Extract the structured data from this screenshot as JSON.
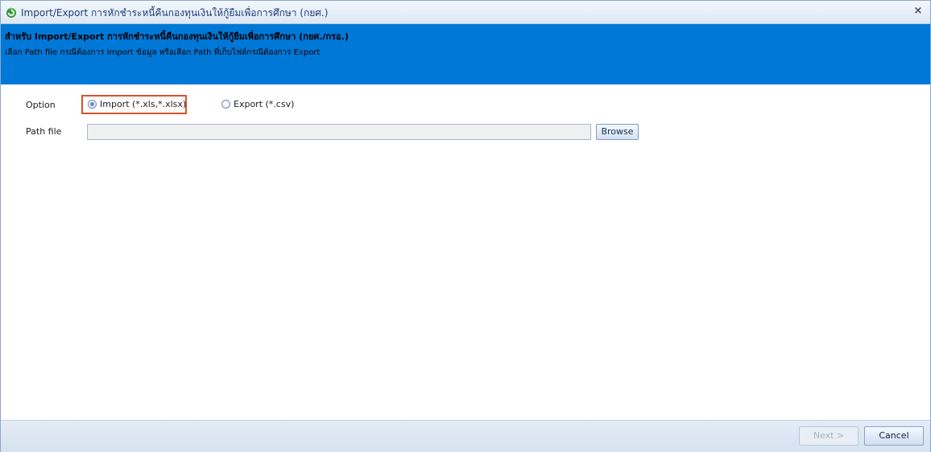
{
  "window": {
    "title": "Import/Export การหักชำระหนี้คืนกองทุนเงินให้กู้ยืมเพื่อการศึกษา (กยศ.)",
    "close_symbol": "×",
    "icon": "app-logo-icon"
  },
  "banner": {
    "title": "สำหรับ Import/Export การหักชำระหนี้คืนกองทุนเงินให้กู้ยืมเพื่อการศึกษา (กยศ./กรอ.)",
    "description": "เลือก Path file กรณีต้องการ Import ข้อมูล หรือเลือก Path ที่เก็บไฟล์กรณีต้องการ Export",
    "background_color": "#0078d7"
  },
  "form": {
    "option_label": "Option",
    "import_option": "Import (*.xls,*.xlsx)",
    "export_option": "Export (*.csv)",
    "selected_option": "import",
    "path_label": "Path file",
    "path_value": "",
    "browse_label": "Browse"
  },
  "footer": {
    "next_label": "Next >",
    "cancel_label": "Cancel"
  }
}
